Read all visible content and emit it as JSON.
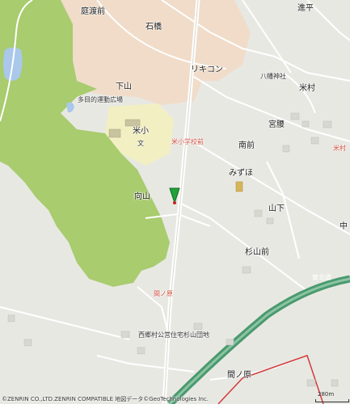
{
  "map": {
    "place_labels": [
      {
        "id": "teitomae",
        "text": "庭渡前"
      },
      {
        "id": "ishibashi",
        "text": "石橋"
      },
      {
        "id": "rikikon",
        "text": "リキコン"
      },
      {
        "id": "shimoyama",
        "text": "下山"
      },
      {
        "id": "tamokuteki",
        "text": "多目的運動広場"
      },
      {
        "id": "yoneshou",
        "text": "米小"
      },
      {
        "id": "yonemura",
        "text": "米村"
      },
      {
        "id": "hachimanjinja",
        "text": "八幡神社"
      },
      {
        "id": "miyakoshi",
        "text": "宮腰"
      },
      {
        "id": "minamimae",
        "text": "南前"
      },
      {
        "id": "mizuho",
        "text": "みずほ"
      },
      {
        "id": "mukaiyama",
        "text": "向山"
      },
      {
        "id": "yamashita",
        "text": "山下"
      },
      {
        "id": "sugiyamamae",
        "text": "杉山前"
      },
      {
        "id": "nishigomura",
        "text": "西郷村公営住宅杉山団地"
      },
      {
        "id": "kannohara",
        "text": "間ノ原"
      },
      {
        "id": "shinpei",
        "text": "進平"
      },
      {
        "id": "naka",
        "text": "中"
      }
    ],
    "small_labels": [
      {
        "id": "bun",
        "text": "文"
      },
      {
        "id": "yonekoumae",
        "text": "米小学校前"
      },
      {
        "id": "kannohara_stop",
        "text": "間ノ原"
      },
      {
        "id": "yone_right",
        "text": "米村"
      },
      {
        "id": "highway",
        "text": "東北道"
      }
    ],
    "scale_text": "280m",
    "copyright": "©ZENRIN CO.,LTD.ZENRIN COMPATIBLE 地図データ©GeoTechnologies Inc.",
    "marker": {
      "icon": "map-pin-icon",
      "color": "#1fa33a"
    },
    "colors": {
      "forest": "#a8cc6e",
      "urban": "#f0dcc8",
      "school": "#f2efc2",
      "highway": "#4a9a6e",
      "water": "#a9c8ea",
      "base": "#e8e8e3"
    }
  }
}
